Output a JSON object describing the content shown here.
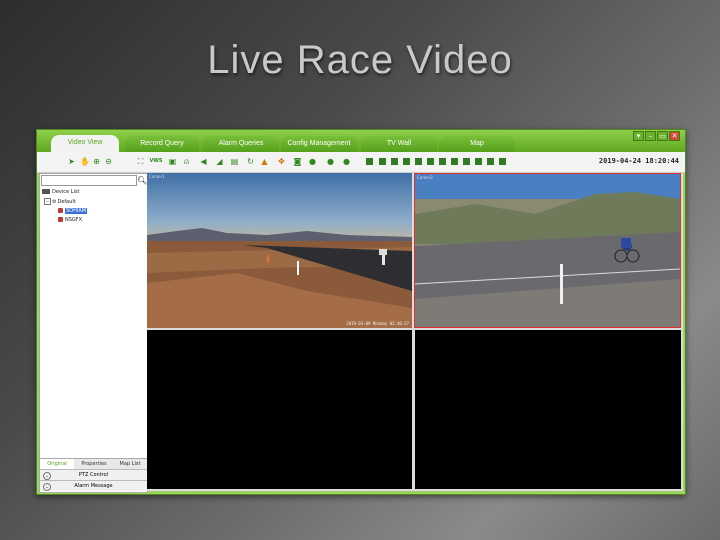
{
  "slide": {
    "title": "Live Race Video"
  },
  "app": {
    "tabs": [
      {
        "label": "Video View"
      },
      {
        "label": "Record Query"
      },
      {
        "label": "Alarm Queries"
      },
      {
        "label": "Config Management"
      },
      {
        "label": "TV Wall"
      },
      {
        "label": "Map"
      }
    ],
    "window_controls": [
      "▾",
      "–",
      "▭",
      "✕"
    ],
    "datetime": "2019-04-24 18:20:44",
    "toolbar_icons": [
      "pointer-icon",
      "hand-icon",
      "zoom-in-icon",
      "zoom-out-icon",
      "fullscreen-icon",
      "vws-icon",
      "snapshot-icon",
      "microphone-icon",
      "speaker-icon",
      "broadcast-icon",
      "record-icon",
      "refresh-icon",
      "alarm-icon",
      "fit-icon",
      "stop-icon",
      "play-icon",
      "pause-icon",
      "clock-icon"
    ],
    "tree": {
      "root": "Device List",
      "group": "Default",
      "devices": [
        {
          "label": "SOHIAM",
          "selected": true
        },
        {
          "label": "NSGFX",
          "selected": false
        }
      ]
    },
    "bottom_tabs": [
      {
        "label": "Original"
      },
      {
        "label": "Properties"
      },
      {
        "label": "Map List"
      }
    ],
    "sections": [
      {
        "label": "PTZ Control"
      },
      {
        "label": "Alarm Message"
      }
    ],
    "panes": [
      {
        "label": "Camer1",
        "osd": "2019-03-09 Monday 02:40:37"
      },
      {
        "label": "Camer2",
        "osd": ""
      },
      {
        "label": "",
        "osd": ""
      },
      {
        "label": "",
        "osd": ""
      }
    ]
  }
}
